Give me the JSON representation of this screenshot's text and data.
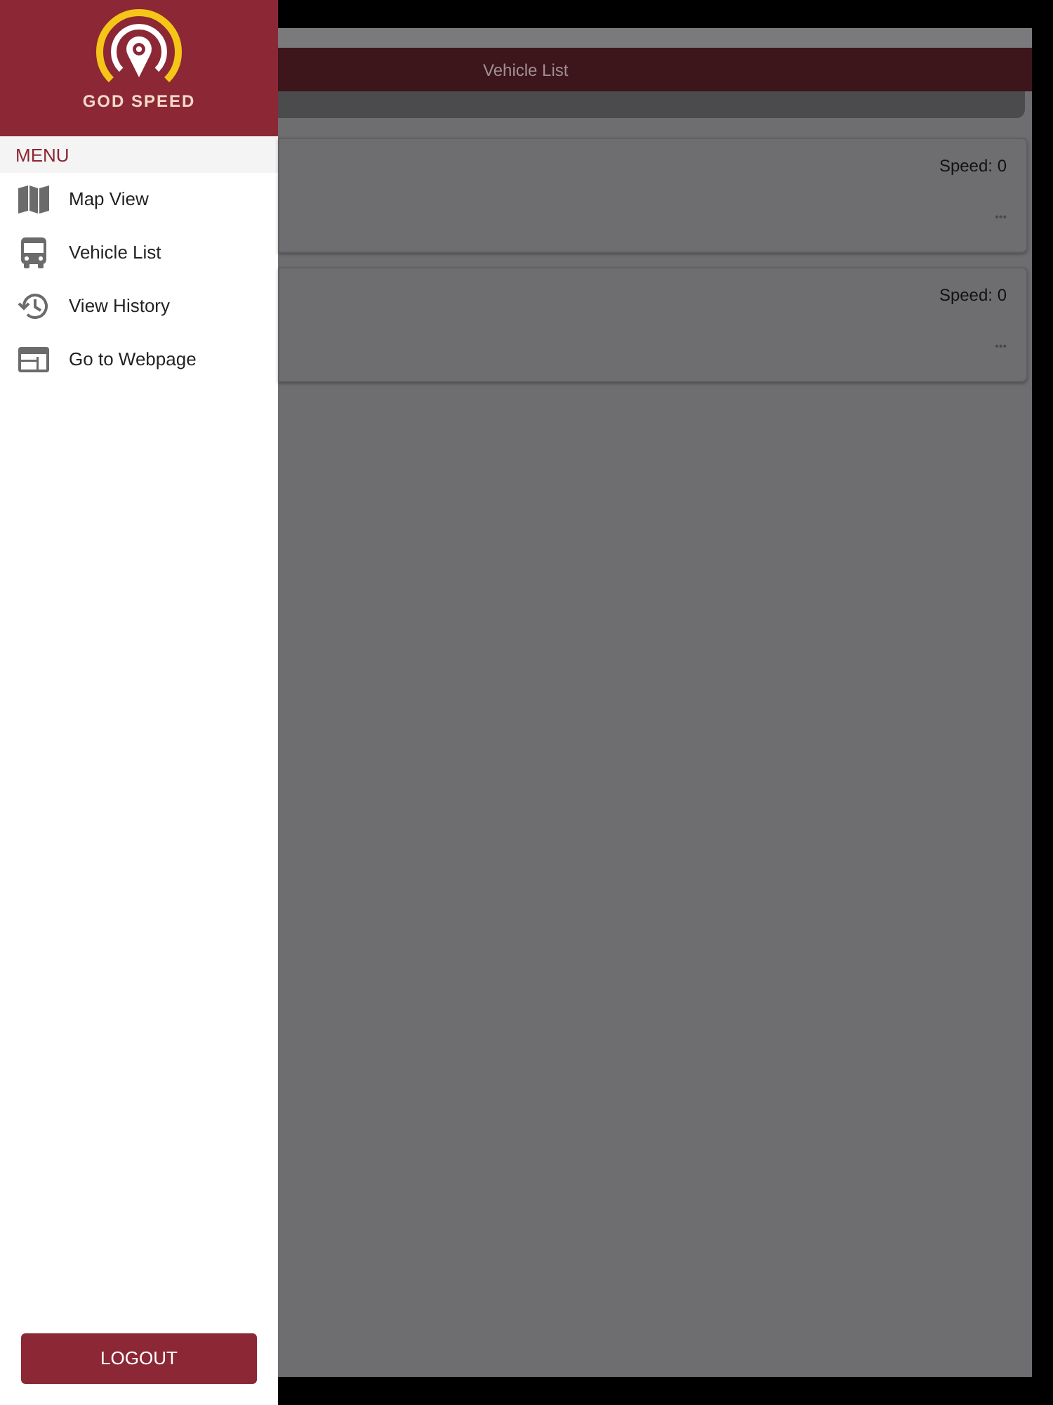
{
  "drawer": {
    "brand": "GOD SPEED",
    "menu_heading": "MENU",
    "items": [
      {
        "label": "Map View",
        "kind": "map"
      },
      {
        "label": "Vehicle List",
        "kind": "bus"
      },
      {
        "label": "View History",
        "kind": "history"
      },
      {
        "label": "Go to Webpage",
        "kind": "web"
      }
    ],
    "logout": "LOGOUT"
  },
  "header": {
    "title": "Vehicle List"
  },
  "vehicles": [
    {
      "speed": "Speed: 0",
      "more": "•••"
    },
    {
      "speed": "Speed: 0",
      "more": "•••"
    }
  ]
}
